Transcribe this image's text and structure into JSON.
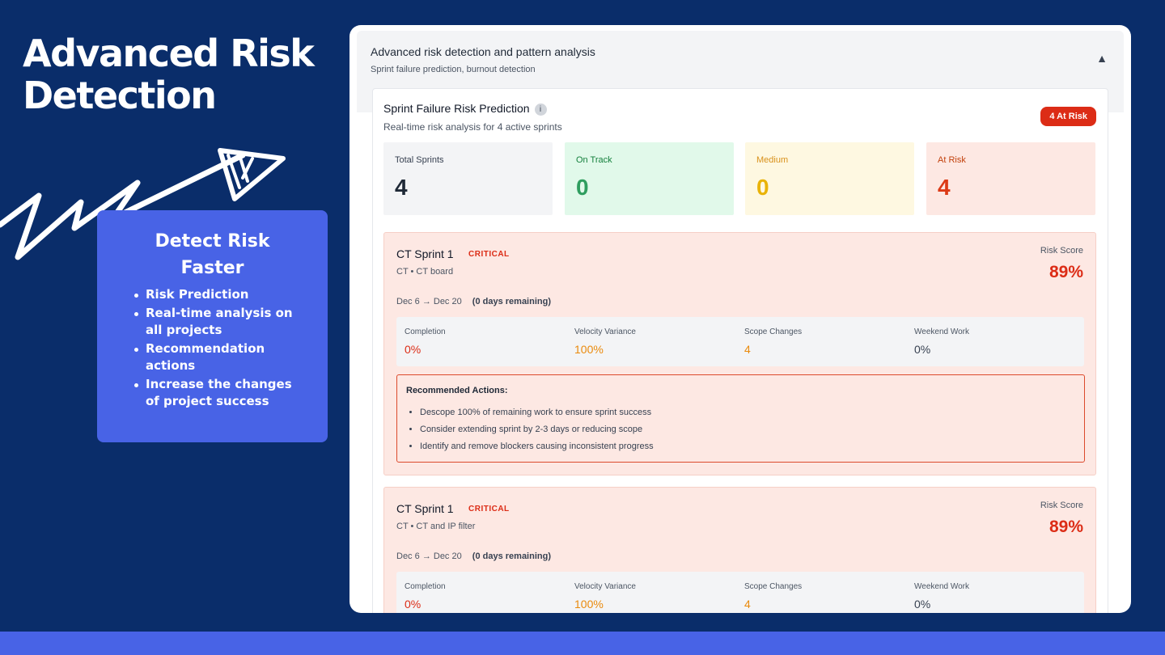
{
  "hero": {
    "title": "Advanced Risk Detection"
  },
  "feature": {
    "heading": "Detect Risk Faster",
    "bullets": [
      "Risk Prediction",
      "Real-time analysis on all projects",
      "Recommendation actions",
      "Increase the changes of project success"
    ]
  },
  "panel": {
    "title": "Advanced risk detection and pattern analysis",
    "subtitle": "Sprint failure prediction, burnout detection",
    "collapse_icon": "triangle-up-icon"
  },
  "prediction": {
    "title": "Sprint Failure Risk Prediction",
    "info_icon": "i",
    "subtitle": "Real-time risk analysis for 4 active sprints",
    "badge": "4 At Risk",
    "stats": [
      {
        "label": "Total Sprints",
        "value": "4",
        "bg": "#f3f4f6",
        "label_color": "#374151",
        "value_color": "#1f2937"
      },
      {
        "label": "On Track",
        "value": "0",
        "bg": "#e1f9ea",
        "label_color": "#15803d",
        "value_color": "#2f9e5f"
      },
      {
        "label": "Medium",
        "value": "0",
        "bg": "#fef8e1",
        "label_color": "#d9911b",
        "value_color": "#e9b308"
      },
      {
        "label": "At Risk",
        "value": "4",
        "bg": "#fde8e3",
        "label_color": "#c2410c",
        "value_color": "#dc3a16"
      }
    ]
  },
  "sprints": [
    {
      "name": "CT Sprint 1",
      "severity": "CRITICAL",
      "board": "CT • CT board",
      "start": "Dec 6",
      "arrow": "→",
      "end": "Dec 20",
      "remaining": "(0 days remaining)",
      "risk_label": "Risk Score",
      "risk_value": "89%",
      "metrics": [
        {
          "label": "Completion",
          "value": "0%",
          "color": "#dc2c16"
        },
        {
          "label": "Velocity Variance",
          "value": "100%",
          "color": "#ea8a0c"
        },
        {
          "label": "Scope Changes",
          "value": "4",
          "color": "#ea8a0c"
        },
        {
          "label": "Weekend Work",
          "value": "0%",
          "color": "#374151"
        }
      ],
      "actions_title": "Recommended Actions:",
      "actions": [
        "Descope 100% of remaining work to ensure sprint success",
        "Consider extending sprint by 2-3 days or reducing scope",
        "Identify and remove blockers causing inconsistent progress"
      ]
    },
    {
      "name": "CT Sprint 1",
      "severity": "CRITICAL",
      "board": "CT • CT and IP filter",
      "start": "Dec 6",
      "arrow": "→",
      "end": "Dec 20",
      "remaining": "(0 days remaining)",
      "risk_label": "Risk Score",
      "risk_value": "89%",
      "metrics": [
        {
          "label": "Completion",
          "value": "0%",
          "color": "#dc2c16"
        },
        {
          "label": "Velocity Variance",
          "value": "100%",
          "color": "#ea8a0c"
        },
        {
          "label": "Scope Changes",
          "value": "4",
          "color": "#ea8a0c"
        },
        {
          "label": "Weekend Work",
          "value": "0%",
          "color": "#374151"
        }
      ]
    }
  ]
}
